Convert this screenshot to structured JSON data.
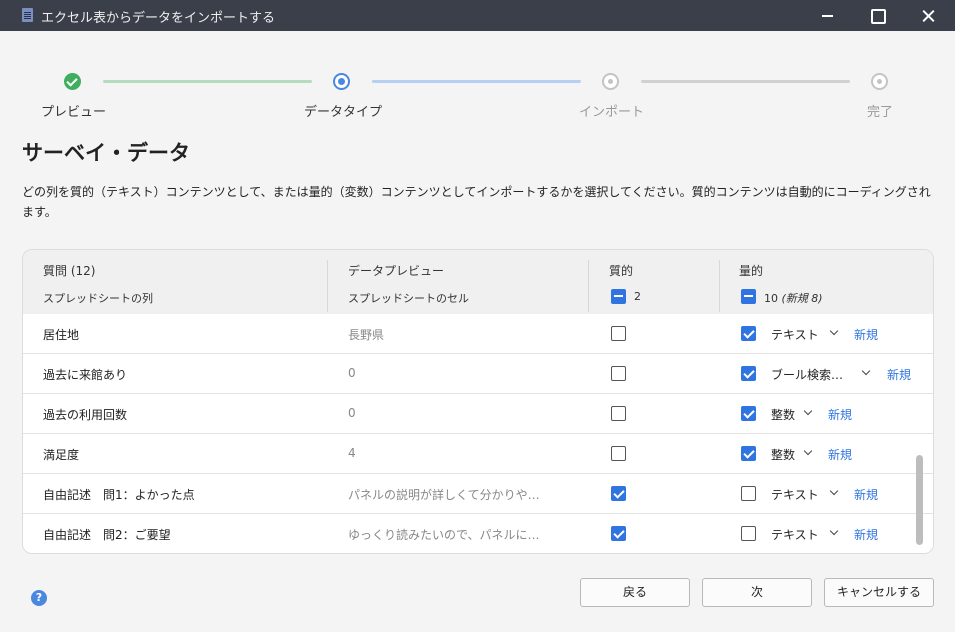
{
  "window": {
    "title": "エクセル表からデータをインポートする",
    "icon": "document-icon"
  },
  "steps": [
    {
      "label": "プレビュー",
      "state": "done"
    },
    {
      "label": "データタイプ",
      "state": "current"
    },
    {
      "label": "インポート",
      "state": "future"
    },
    {
      "label": "完了",
      "state": "future"
    }
  ],
  "page": {
    "title": "サーベイ・データ",
    "description": "どの列を質的（テキスト）コンテンツとして、または量的（変数）コンテンツとしてインポートするかを選択してください。質的コンテンツは自動的にコーディングされます。"
  },
  "table": {
    "header": {
      "question_title": "質問 (12)",
      "question_sub": "スプレッドシートの列",
      "preview_title": "データプレビュー",
      "preview_sub": "スプレッドシートのセル",
      "qual_title": "質的",
      "qual_count": "2",
      "quant_title": "量的",
      "quant_count": "10",
      "quant_new": "(新規 8)"
    },
    "rows": [
      {
        "question": "居住地",
        "preview": "長野県",
        "qualitative": false,
        "quantitative": true,
        "type": "テキスト",
        "new": "新規"
      },
      {
        "question": "過去に来館あり",
        "preview": "0",
        "qualitative": false,
        "quantitative": true,
        "type": "ブール検索…",
        "new": "新規"
      },
      {
        "question": "過去の利用回数",
        "preview": "0",
        "qualitative": false,
        "quantitative": true,
        "type": "整数",
        "new": "新規"
      },
      {
        "question": "満足度",
        "preview": "4",
        "qualitative": false,
        "quantitative": true,
        "type": "整数",
        "new": "新規"
      },
      {
        "question": "自由記述　問1：よかった点",
        "preview": "パネルの説明が詳しくて分かりや…",
        "qualitative": true,
        "quantitative": false,
        "type": "テキスト",
        "new": "新規"
      },
      {
        "question": "自由記述　問2：ご要望",
        "preview": "ゆっくり読みたいので、パネルに…",
        "qualitative": true,
        "quantitative": false,
        "type": "テキスト",
        "new": "新規"
      }
    ]
  },
  "footer": {
    "help": "?",
    "back": "戻る",
    "next": "次",
    "cancel": "キャンセルする"
  },
  "colors": {
    "accent": "#2f74e0",
    "done": "#3fae5f",
    "titlebar": "#3b3f4a"
  }
}
